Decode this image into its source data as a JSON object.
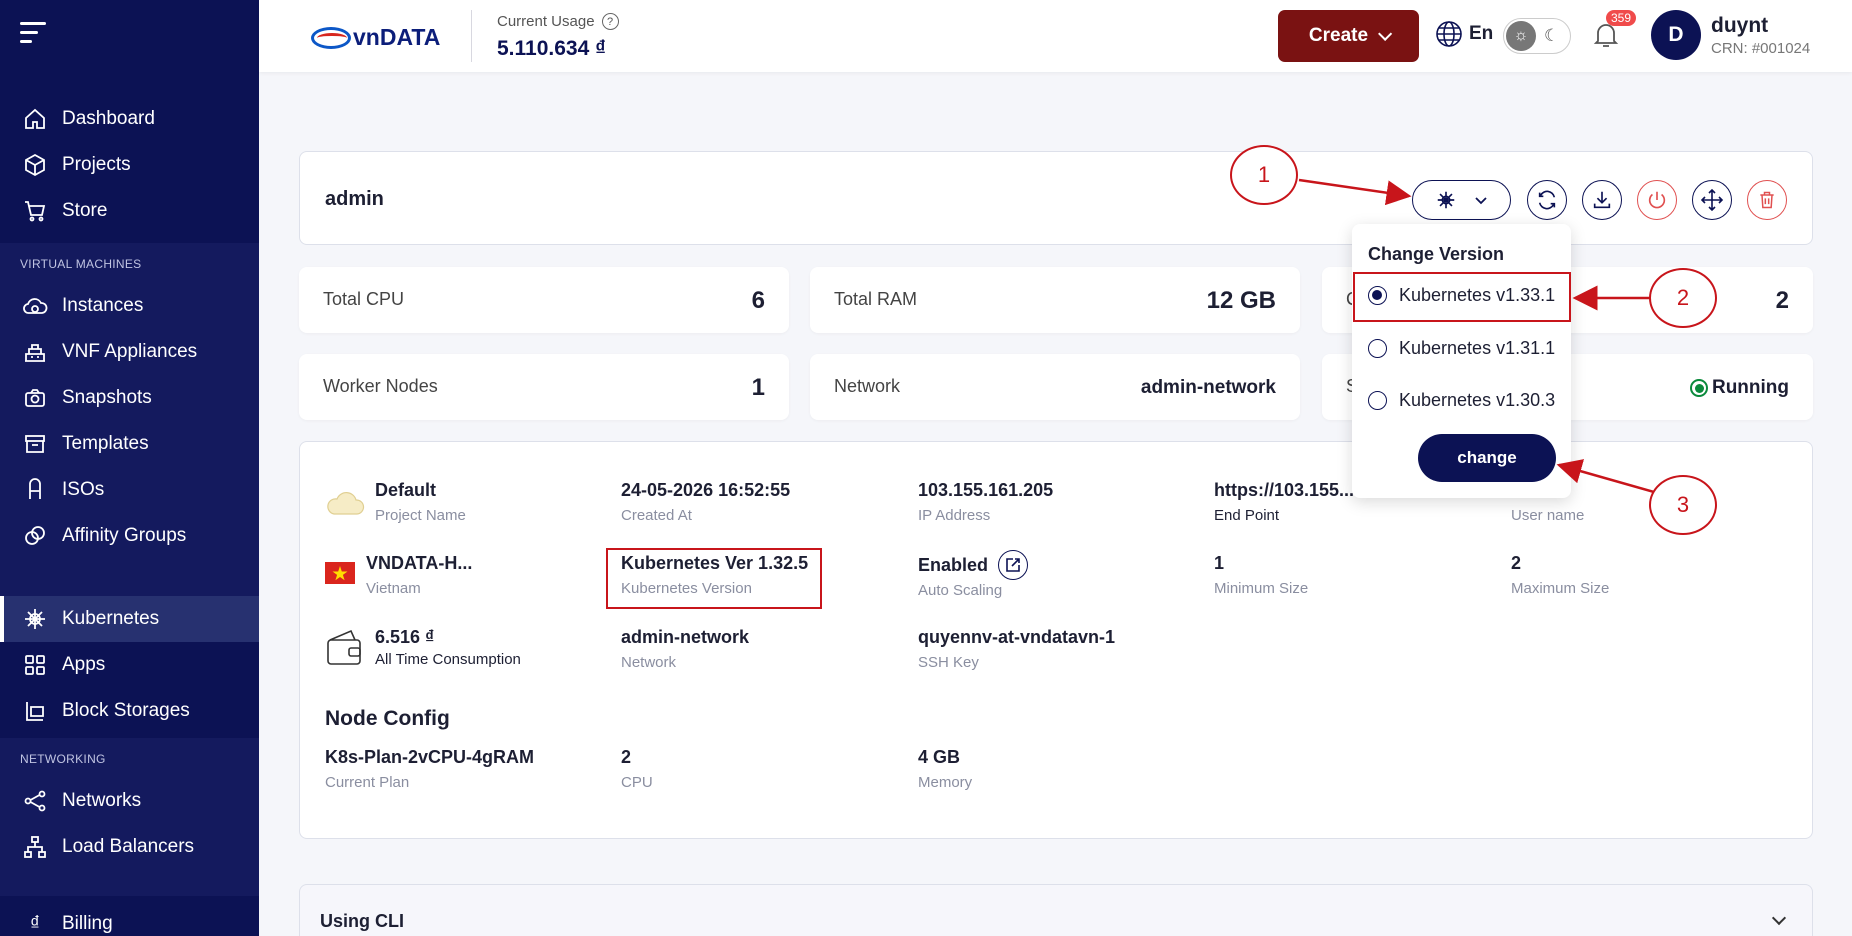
{
  "sidebar": {
    "top_items": [
      {
        "label": "Dashboard",
        "icon": "home-icon"
      },
      {
        "label": "Projects",
        "icon": "cube-icon"
      },
      {
        "label": "Store",
        "icon": "cart-icon"
      }
    ],
    "vm_heading": "VIRTUAL MACHINES",
    "vm_items": [
      {
        "label": "Instances",
        "icon": "cloud-icon"
      },
      {
        "label": "VNF Appliances",
        "icon": "firewall-icon"
      },
      {
        "label": "Snapshots",
        "icon": "camera-icon"
      },
      {
        "label": "Templates",
        "icon": "archive-icon"
      },
      {
        "label": "ISOs",
        "icon": "disc-icon"
      },
      {
        "label": "Affinity Groups",
        "icon": "circles-icon"
      }
    ],
    "middle_items": [
      {
        "label": "Kubernetes",
        "icon": "helm-icon",
        "active": true
      },
      {
        "label": "Apps",
        "icon": "grid-icon"
      },
      {
        "label": "Block Storages",
        "icon": "storage-icon"
      }
    ],
    "net_heading": "NETWORKING",
    "net_items": [
      {
        "label": "Networks",
        "icon": "network-icon"
      },
      {
        "label": "Load Balancers",
        "icon": "balancer-icon"
      }
    ],
    "bottom_items": [
      {
        "label": "Billing",
        "icon": "dong-icon"
      }
    ]
  },
  "header": {
    "logo_text": "vnDATA",
    "usage_label": "Current Usage",
    "usage_value": "5.110.634 ₫",
    "create_label": "Create",
    "lang": "En",
    "notification_count": "359",
    "avatar_initial": "D",
    "user_name": "duynt",
    "user_crn": "CRN: #001024"
  },
  "cluster": {
    "name": "admin",
    "stats": [
      {
        "label": "Total CPU",
        "value": "6"
      },
      {
        "label": "Total RAM",
        "value": "12 GB"
      },
      {
        "label": "C",
        "value": "2"
      },
      {
        "label": "Worker Nodes",
        "value": "1"
      },
      {
        "label": "Network",
        "value": "admin-network"
      },
      {
        "label": "S",
        "value": "Running"
      }
    ],
    "details": {
      "project": {
        "value": "Default",
        "label": "Project Name"
      },
      "created": {
        "value": "24-05-2026 16:52:55",
        "label": "Created At"
      },
      "ip": {
        "value": "103.155.161.205",
        "label": "IP Address"
      },
      "endpoint": {
        "value": "https://103.155...",
        "label": "End Point"
      },
      "username": {
        "value": "",
        "label": "User name"
      },
      "zone": {
        "value": "VNDATA-H...",
        "label": "Vietnam"
      },
      "k8s_version": {
        "value": "Kubernetes Ver 1.32.5",
        "label": "Kubernetes Version"
      },
      "autoscaling": {
        "value": "Enabled",
        "label": "Auto Scaling"
      },
      "min_size": {
        "value": "1",
        "label": "Minimum Size"
      },
      "max_size": {
        "value": "2",
        "label": "Maximum Size"
      },
      "consumption": {
        "value": "6.516 ₫",
        "label": "All Time Consumption"
      },
      "network": {
        "value": "admin-network",
        "label": "Network"
      },
      "ssh_key": {
        "value": "quyennv-at-vndatavn-1",
        "label": "SSH Key"
      }
    },
    "node_config_title": "Node Config",
    "node_config": {
      "plan": {
        "value": "K8s-Plan-2vCPU-4gRAM",
        "label": "Current Plan"
      },
      "cpu": {
        "value": "2",
        "label": "CPU"
      },
      "memory": {
        "value": "4 GB",
        "label": "Memory"
      }
    },
    "cli_title": "Using CLI"
  },
  "dropdown": {
    "title": "Change Version",
    "options": [
      {
        "label": "Kubernetes v1.33.1",
        "selected": true
      },
      {
        "label": "Kubernetes v1.31.1",
        "selected": false
      },
      {
        "label": "Kubernetes v1.30.3",
        "selected": false
      }
    ],
    "button": "change"
  },
  "annotations": [
    "1",
    "2",
    "3"
  ],
  "colors": {
    "sidebar": "#0c1254",
    "create_button": "#7a1212",
    "annotation": "#c8151b",
    "running": "#0b8a3c"
  }
}
